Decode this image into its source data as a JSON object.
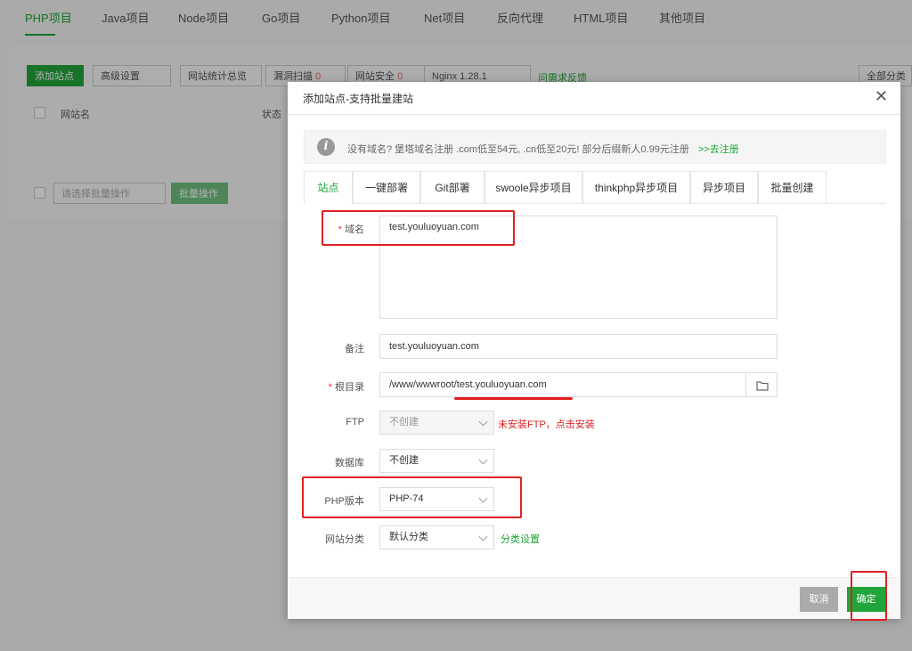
{
  "top_tabs": [
    "PHP项目",
    "Java项目",
    "Node项目",
    "Go项目",
    "Python项目",
    "Net项目",
    "反向代理",
    "HTML项目",
    "其他项目"
  ],
  "toolbar": {
    "add_site": "添加站点",
    "advanced": "高级设置",
    "stats": "网站统计总览",
    "vuln": "漏洞扫描",
    "vuln_count": "0",
    "security": "网站安全",
    "security_count": "0",
    "nginx": "Nginx 1.28.1",
    "feedback": "问需求反馈",
    "all_categories": "全部分类"
  },
  "table": {
    "col_name": "网站名",
    "col_status": "状态",
    "batch_select": "请选择批量操作",
    "batch_btn": "批量操作"
  },
  "dialog": {
    "title": "添加站点-支持批量建站",
    "notice": "没有域名? 堡塔域名注册 .com低至54元, .cn低至20元! 部分后缀新人0.99元注册",
    "notice_link": ">>去注册",
    "tabs": [
      "站点",
      "一键部署",
      "Git部署",
      "swoole异步项目",
      "thinkphp异步项目",
      "异步项目",
      "批量创建"
    ],
    "domain_label": "域名",
    "domain_value": "test.youluoyuan.com",
    "remark_label": "备注",
    "remark_value": "test.youluoyuan.com",
    "root_label": "根目录",
    "root_value": "/www/wwwroot/test.youluoyuan.com",
    "ftp_label": "FTP",
    "ftp_value": "不创建",
    "ftp_hint": "未安装FTP，点击安装",
    "db_label": "数据库",
    "db_value": "不创建",
    "php_label": "PHP版本",
    "php_value": "PHP-74",
    "category_label": "网站分类",
    "category_value": "默认分类",
    "category_link": "分类设置",
    "cancel": "取消",
    "confirm": "确定"
  },
  "colors": {
    "accent": "#20a53a",
    "annotation": "#e02020",
    "warning": "#e02020"
  }
}
